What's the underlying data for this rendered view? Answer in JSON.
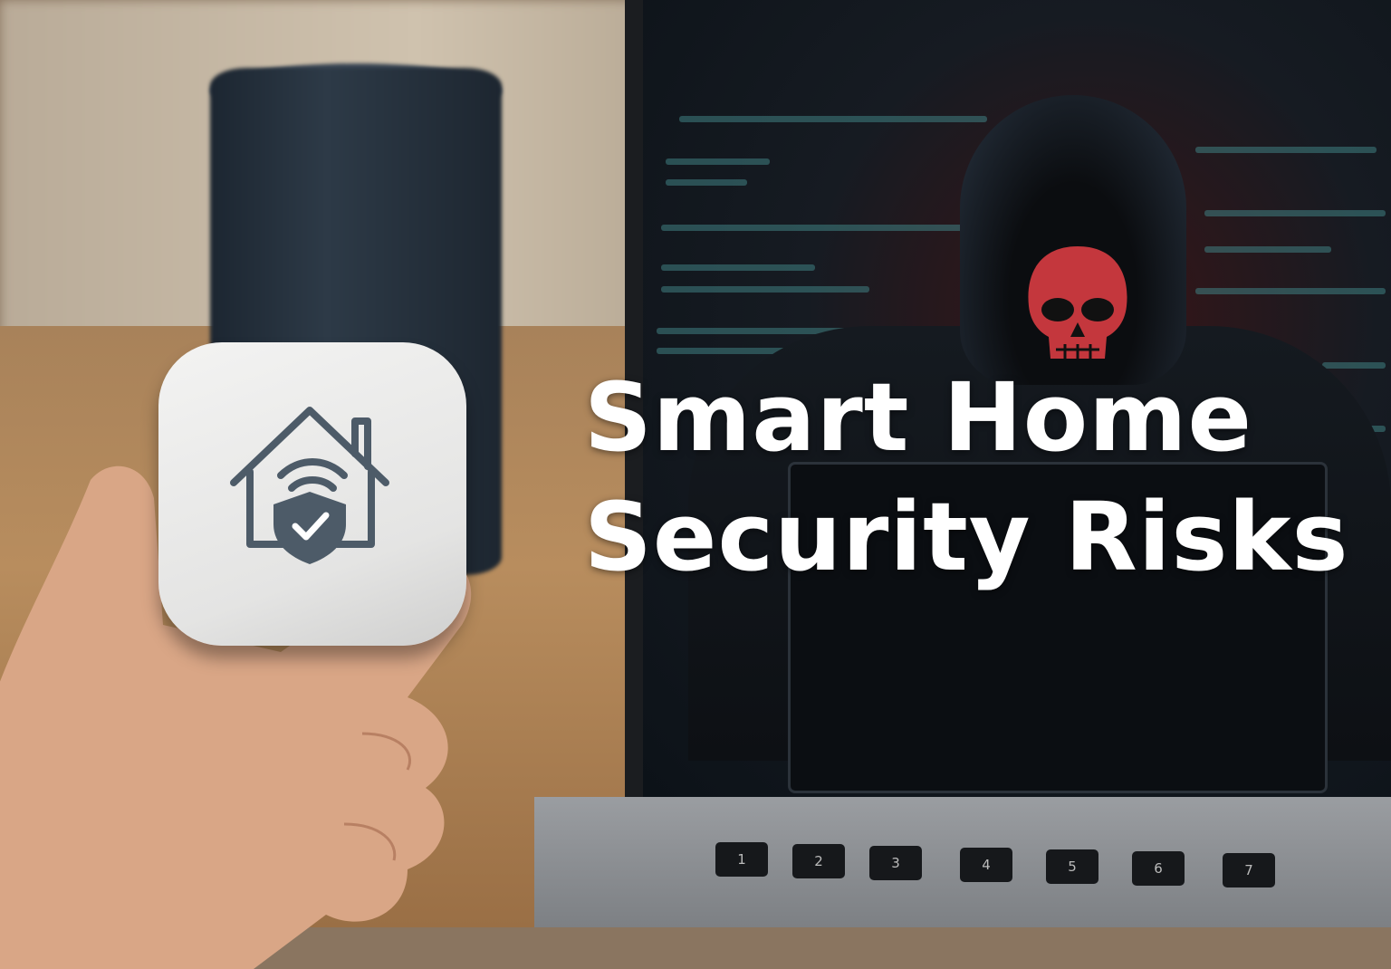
{
  "headline": {
    "line1": "Smart Home",
    "line2": "Security Risks"
  },
  "colors": {
    "title": "#ffffff",
    "skull": "#c4373d",
    "icon": "#4d5b68"
  },
  "keyboard_keys": [
    "1",
    "2",
    "3",
    "4",
    "5",
    "6",
    "7"
  ]
}
